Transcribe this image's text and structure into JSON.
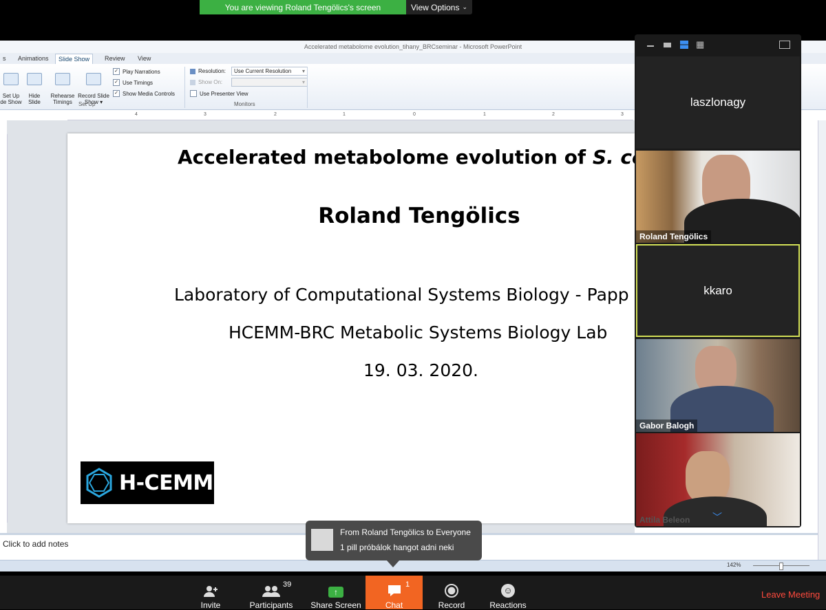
{
  "banner": {
    "viewing_text": "You are viewing Roland Tengölics's screen",
    "view_options_label": "View Options"
  },
  "ppt": {
    "window_title": "Accelerated metabolome evolution_tihany_BRCseminar - Microsoft PowerPoint",
    "tabs": [
      {
        "label": "s"
      },
      {
        "label": "Animations"
      },
      {
        "label": "Slide Show"
      },
      {
        "label": "Review"
      },
      {
        "label": "View"
      }
    ],
    "active_tab": "Slide Show",
    "ribbon": {
      "setup_show": "Set Up\nde Show",
      "hide_slide": "Hide\nSlide",
      "rehearse": "Rehearse\nTimings",
      "record": "Record Slide\nShow ▾",
      "play_narrations": "Play Narrations",
      "use_timings": "Use Timings",
      "show_media_controls": "Show Media Controls",
      "group_setup": "Set Up",
      "resolution_label": "Resolution:",
      "resolution_value": "Use Current Resolution",
      "show_on_label": "Show On:",
      "use_presenter_view": "Use Presenter View",
      "group_monitors": "Monitors"
    },
    "ruler_numbers": [
      "4",
      "3",
      "2",
      "1",
      "0",
      "1",
      "2",
      "3"
    ],
    "notes_placeholder": "Click to add notes",
    "zoom_level": "142%"
  },
  "slide": {
    "title_prefix": "Accelerated metabolome evolution of ",
    "title_italic": "S. cerev",
    "author": "Roland Tengölics",
    "line1": "Laboratory of Computational Systems Biology  - Papp",
    "line2": "HCEMM-BRC Metabolic Systems Biology Lab",
    "date": "19. 03. 2020.",
    "logo_text": "H-CEMM"
  },
  "participants": [
    {
      "name": "laszlonagy",
      "video": false
    },
    {
      "name": "Roland Tengölics",
      "video": true
    },
    {
      "name": "kkaro",
      "video": false,
      "active_speaker": true
    },
    {
      "name": "Gabor Balogh",
      "video": true
    },
    {
      "name": "Attila Beleon",
      "video": true
    }
  ],
  "chat_popup": {
    "from": "From Roland Tengölics to Everyone",
    "message": "1 pill próbálok hangot adni neki"
  },
  "toolbar": {
    "invite": "Invite",
    "participants": "Participants",
    "participants_count": "39",
    "share_screen": "Share Screen",
    "chat": "Chat",
    "chat_badge": "1",
    "record": "Record",
    "reactions": "Reactions",
    "leave": "Leave Meeting"
  },
  "colors": {
    "share_green": "#3cb043",
    "chat_orange": "#f26522",
    "leave_red": "#ff4a3d",
    "active_outline": "#d4e157"
  },
  "icons": [
    "chevron-down-icon",
    "person-add-icon",
    "participants-icon",
    "share-arrow-icon",
    "chat-bubble-icon",
    "record-icon",
    "smiley-icon",
    "grid-view-icon"
  ]
}
